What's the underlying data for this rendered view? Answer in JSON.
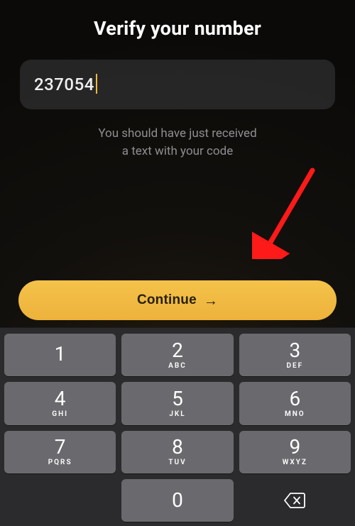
{
  "title": "Verify your number",
  "code_input": {
    "value": "237054"
  },
  "help_line1": "You should have just received",
  "help_line2": "a text with your code",
  "cta_label": "Continue",
  "keypad": {
    "keys": [
      {
        "digit": "1",
        "letters": ""
      },
      {
        "digit": "2",
        "letters": "ABC"
      },
      {
        "digit": "3",
        "letters": "DEF"
      },
      {
        "digit": "4",
        "letters": "GHI"
      },
      {
        "digit": "5",
        "letters": "JKL"
      },
      {
        "digit": "6",
        "letters": "MNO"
      },
      {
        "digit": "7",
        "letters": "PQRS"
      },
      {
        "digit": "8",
        "letters": "TUV"
      },
      {
        "digit": "9",
        "letters": "WXYZ"
      },
      {
        "digit": "0",
        "letters": ""
      }
    ]
  },
  "colors": {
    "accent": "#f0b83e",
    "annotation": "#ff1a1a"
  }
}
